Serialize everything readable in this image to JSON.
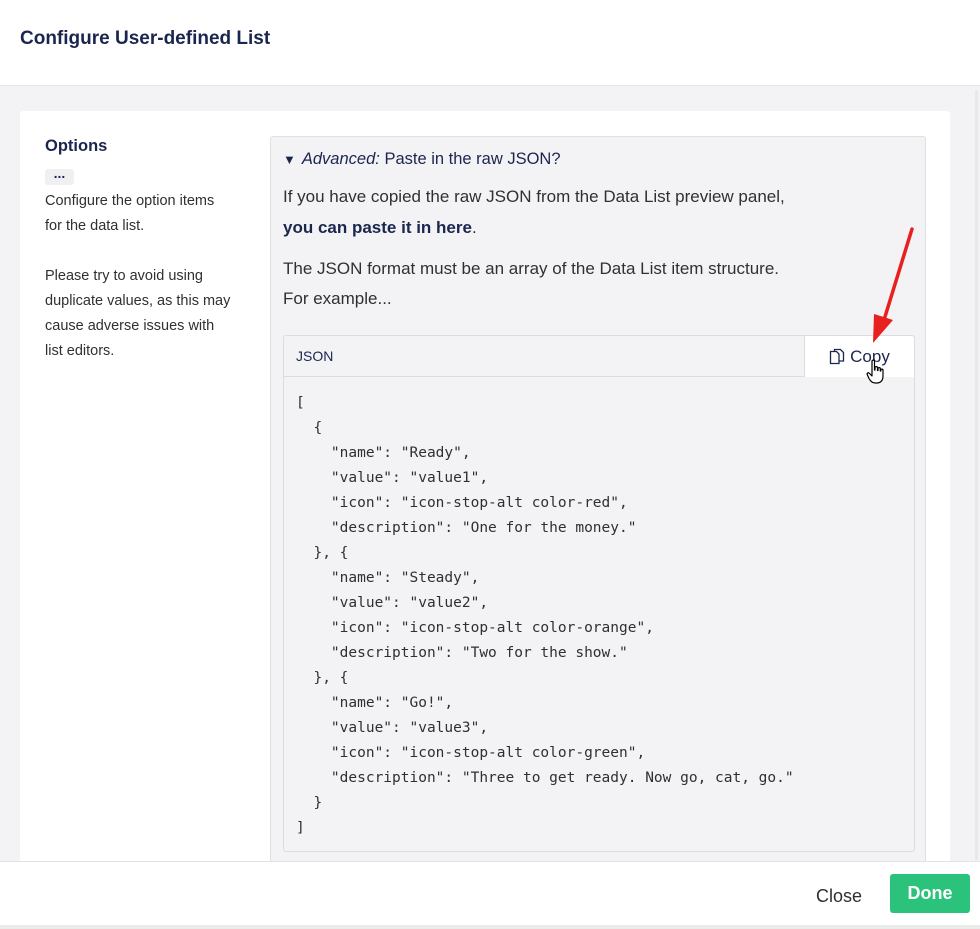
{
  "dialog": {
    "title": "Configure User-defined List"
  },
  "property": {
    "label": "Options",
    "more_label": "...",
    "description_lines": [
      "Configure the option items",
      "for the data list."
    ],
    "warning_lines": [
      "Please try to avoid using",
      "duplicate values, as this may",
      "cause adverse issues with",
      "list editors."
    ]
  },
  "advanced": {
    "summary_prefix": "Advanced:",
    "summary_text": " Paste in the raw JSON?",
    "p1_line1": "If you have copied the raw JSON from the Data List preview panel,",
    "p1_bold": "you can paste it in here",
    "p1_end": ".",
    "p2_line1": "The JSON format must be an array of the Data List item structure.",
    "p2_line2": "For example...",
    "code_lang": "JSON",
    "copy_label": "Copy",
    "code": "[\n  {\n    \"name\": \"Ready\",\n    \"value\": \"value1\",\n    \"icon\": \"icon-stop-alt color-red\",\n    \"description\": \"One for the money.\"\n  }, {\n    \"name\": \"Steady\",\n    \"value\": \"value2\",\n    \"icon\": \"icon-stop-alt color-orange\",\n    \"description\": \"Two for the show.\"\n  }, {\n    \"name\": \"Go!\",\n    \"value\": \"value3\",\n    \"icon\": \"icon-stop-alt color-green\",\n    \"description\": \"Three to get ready. Now go, cat, go.\"\n  }\n]"
  },
  "footer": {
    "close_label": "Close",
    "done_label": "Done"
  },
  "colors": {
    "accent": "#2bc37c",
    "annotation_arrow": "#e8201f",
    "text": "#1b264f"
  },
  "icons": {
    "copy": "copy-icon",
    "cursor": "hand-pointer-icon",
    "arrow": "annotation-arrow-icon"
  }
}
